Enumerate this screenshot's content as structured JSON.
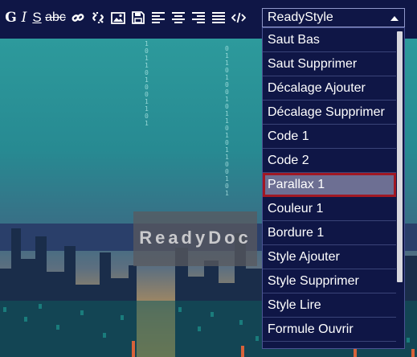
{
  "toolbar": {
    "bold": "G",
    "italic": "I",
    "underline": "S",
    "strike": "abc",
    "icons": [
      "link-icon",
      "unlink-icon",
      "image-icon",
      "save-icon",
      "align-left-icon",
      "align-center-icon",
      "align-right-icon",
      "align-justify-icon",
      "code-icon"
    ],
    "select_value": "ReadyStyle"
  },
  "banner": {
    "logo": "ReadyDoc"
  },
  "dropdown": {
    "items": [
      {
        "label": "Saut Bas"
      },
      {
        "label": "Saut Supprimer"
      },
      {
        "label": "Décalage Ajouter"
      },
      {
        "label": "Décalage Supprimer"
      },
      {
        "label": "Code 1"
      },
      {
        "label": "Code 2"
      },
      {
        "label": "Parallax 1"
      },
      {
        "label": "Couleur 1"
      },
      {
        "label": "Bordure 1"
      },
      {
        "label": "Style Ajouter"
      },
      {
        "label": "Style Supprimer"
      },
      {
        "label": "Style Lire"
      },
      {
        "label": "Formule Ouvrir"
      }
    ],
    "selected_index": 6
  },
  "colors": {
    "toolbar_bg": "#0f1646",
    "selected_outline": "#a01824",
    "selected_bg": "#6d6f93"
  }
}
